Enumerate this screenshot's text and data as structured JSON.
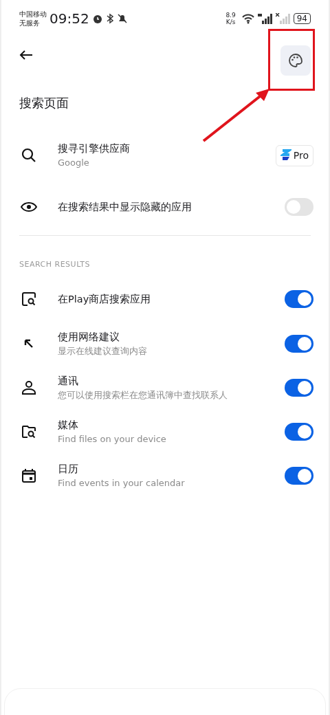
{
  "status_bar": {
    "carrier": "中国移动",
    "service": "无服务",
    "time": "09:52",
    "speed_value": "8.9",
    "speed_unit": "K/s",
    "battery": "94"
  },
  "header": {
    "title": "搜索页面"
  },
  "provider": {
    "kind": "provider",
    "title": "搜寻引擎供应商",
    "subtitle": "Google",
    "badge": "Pro"
  },
  "hidden_apps": {
    "kind": "eye",
    "title": "在搜索结果中显示隐藏的应用",
    "on": false
  },
  "section": {
    "title": "SEARCH RESULTS"
  },
  "items": [
    {
      "kind": "store",
      "title": "在Play商店搜索应用",
      "on": true
    },
    {
      "kind": "web",
      "title": "使用网络建议",
      "subtitle": "显示在线建议查询内容",
      "on": true
    },
    {
      "kind": "contact",
      "title": "通讯",
      "subtitle": "您可以使用搜索栏在您通讯簿中查找联系人",
      "on": true
    },
    {
      "kind": "media",
      "title": "媒体",
      "subtitle": "Find files on your device",
      "on": true
    },
    {
      "kind": "calendar",
      "title": "日历",
      "subtitle": "Find events in your calendar",
      "on": true
    }
  ]
}
